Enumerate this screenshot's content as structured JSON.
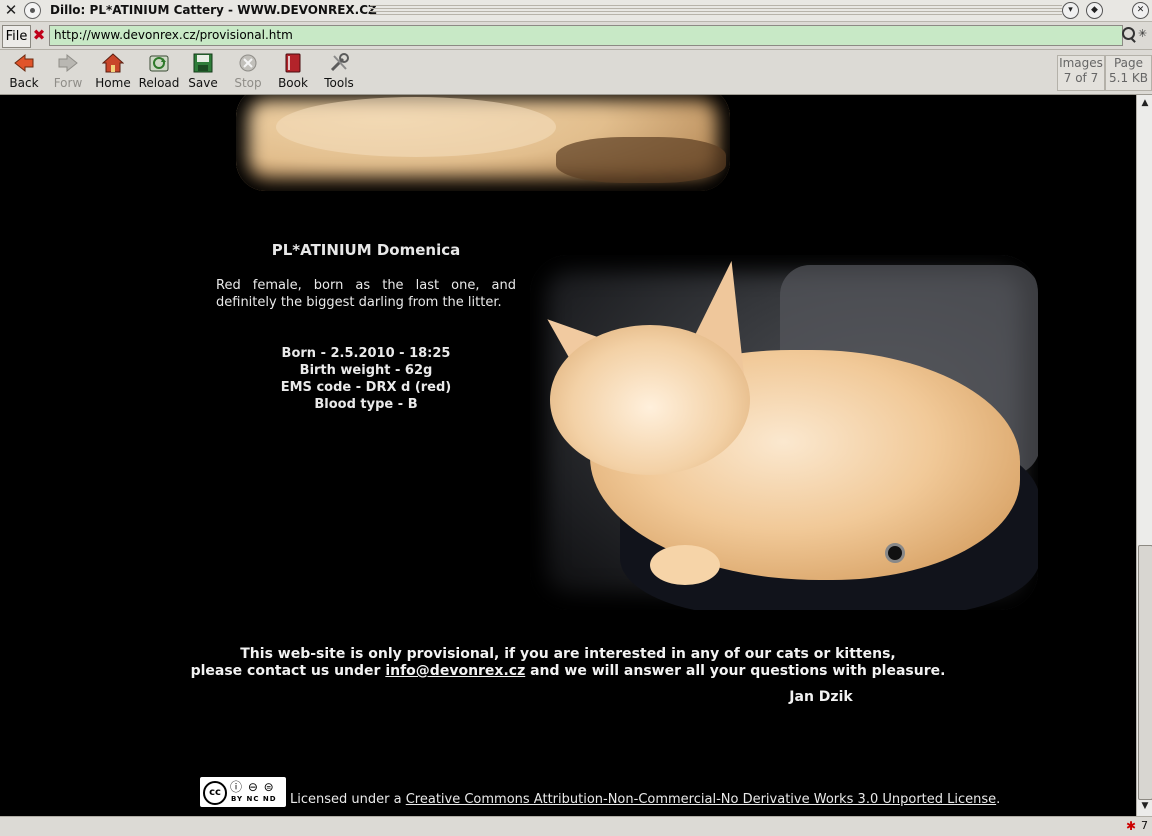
{
  "window": {
    "title": "Dillo: PL*ATINIUM Cattery - WWW.DEVONREX.CZ"
  },
  "location_bar": {
    "file_label": "File",
    "url": "http://www.devonrex.cz/provisional.htm"
  },
  "toolbar": {
    "back": "Back",
    "forward": "Forw",
    "home": "Home",
    "reload": "Reload",
    "save": "Save",
    "stop": "Stop",
    "bookmarks": "Book",
    "tools": "Tools",
    "images_label": "Images",
    "images_count": "7 of 7",
    "page_label": "Page",
    "page_size": "5.1 KB"
  },
  "page": {
    "cat_name": "PL*ATINIUM Domenica",
    "description": "Red female, born as the last one, and definitely the biggest darling from the litter.",
    "facts": [
      "Born - 2.5.2010 - 18:25",
      "Birth weight - 62g",
      "EMS code - DRX d (red)",
      "Blood type - B"
    ],
    "notice_line1": "This web-site is only provisional, if you are interested in any of our cats or kittens,",
    "notice_line2_before": "please contact us under",
    "notice_email": "info@devonrex.cz",
    "notice_line2_after": "and we will answer all your questions with pleasure.",
    "signature": "Jan Dzik",
    "license_prefix": "Licensed under a",
    "license_link": "Creative Commons Attribution-Non-Commercial-No Derivative Works 3.0 Unported License",
    "license_suffix": "."
  },
  "cc_badge": {
    "main": "cc",
    "terms": "BY NC ND"
  },
  "status_bar": {
    "bug_count": "7"
  }
}
